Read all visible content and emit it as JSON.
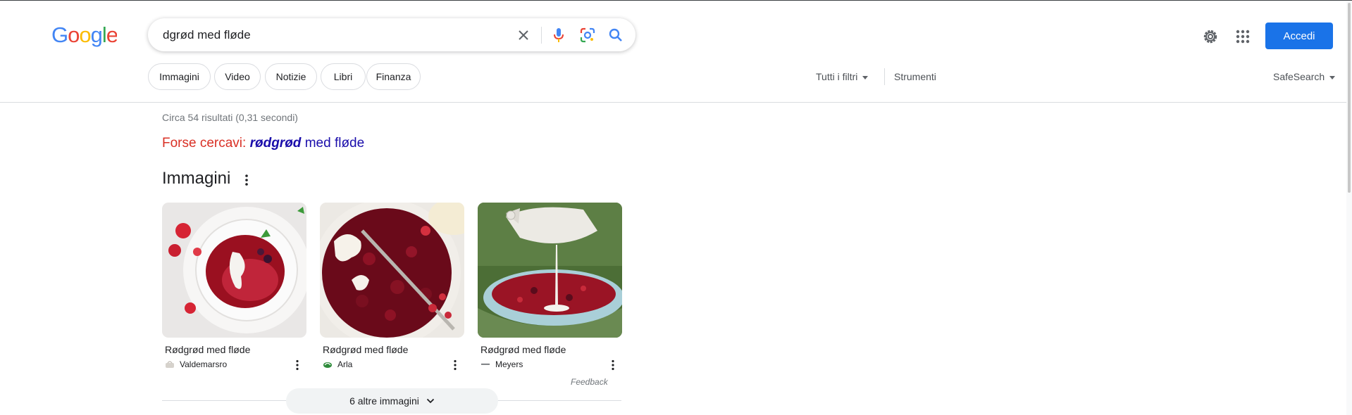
{
  "search": {
    "query": "dgrød med fløde"
  },
  "header": {
    "signin_label": "Accedi"
  },
  "tabs": [
    {
      "label": "Immagini"
    },
    {
      "label": "Video"
    },
    {
      "label": "Notizie"
    },
    {
      "label": "Libri"
    },
    {
      "label": "Finanza"
    }
  ],
  "filters": {
    "all_filters": "Tutti i filtri",
    "tools": "Strumenti",
    "safesearch": "SafeSearch"
  },
  "results": {
    "stats": "Circa 54 risultati (0,31 secondi)",
    "did_you_mean": {
      "label": "Forse cercavi:",
      "bold": "rødgrød",
      "rest": " med fløde"
    }
  },
  "images_section": {
    "title": "Immagini",
    "items": [
      {
        "title": "Rødgrød med fløde",
        "source": "Valdemarsro"
      },
      {
        "title": "Rødgrød med fløde",
        "source": "Arla"
      },
      {
        "title": "Rødgrød med fløde",
        "source": "Meyers"
      }
    ],
    "feedback": "Feedback",
    "more_label": "6 altre immagini"
  },
  "colors": {
    "accent": "#1a73e8",
    "link": "#1a0dab",
    "suggest_red": "#d93025"
  }
}
